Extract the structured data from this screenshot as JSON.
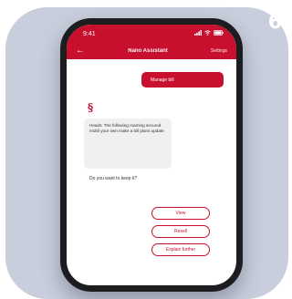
{
  "page": {
    "step_number": "6"
  },
  "status_bar": {
    "time": "9:41",
    "icons": [
      "signal-icon",
      "wifi-icon",
      "battery-icon"
    ]
  },
  "nav_bar": {
    "back_icon": "back-arrow-icon",
    "title": "Nano Assistant",
    "action": "Settings"
  },
  "chat": {
    "user_message": "Manage bill",
    "bot_avatar_icon": "brand-logo-icon",
    "bot_message": "Heads: The following roaming secured mobil your own make a bill plans update",
    "bot_question": "Do you want to keep it?",
    "options": [
      "View",
      "Resell",
      "Explain further"
    ]
  },
  "colors": {
    "accent": "#c8102e",
    "background_card": "#c9cedc",
    "bot_bubble": "#f0f0f2"
  }
}
